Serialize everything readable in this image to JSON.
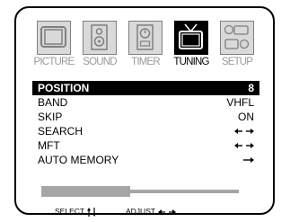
{
  "tabs": [
    {
      "label": "PICTURE",
      "icon": "tv-screen-icon",
      "active": false
    },
    {
      "label": "SOUND",
      "icon": "speaker-icon",
      "active": false
    },
    {
      "label": "TIMER",
      "icon": "timer-icon",
      "active": false
    },
    {
      "label": "TUNING",
      "icon": "antenna-tv-icon",
      "active": true
    },
    {
      "label": "SETUP",
      "icon": "setup-icon",
      "active": false
    }
  ],
  "menu": {
    "position": {
      "label": "POSITION",
      "value": "8"
    },
    "band": {
      "label": "BAND",
      "value": "VHFL"
    },
    "skip": {
      "label": "SKIP",
      "value": "ON"
    },
    "search": {
      "label": "SEARCH",
      "control": "left-right-arrows-icon"
    },
    "mft": {
      "label": "MFT",
      "control": "left-right-arrows-icon"
    },
    "auto_memory": {
      "label": "AUTO MEMORY",
      "control": "right-arrow-icon"
    }
  },
  "tuning_bar": {
    "level": 0.45
  },
  "footer": {
    "select_label": "SELECT",
    "select_icon": "up-down-arrows-icon",
    "adjust_label": "ADJUST",
    "adjust_icon": "left-right-arrows-icon"
  },
  "colors": {
    "highlight": "#000000",
    "inactive": "#9a9a9a",
    "bar": "#a6a6a6"
  }
}
